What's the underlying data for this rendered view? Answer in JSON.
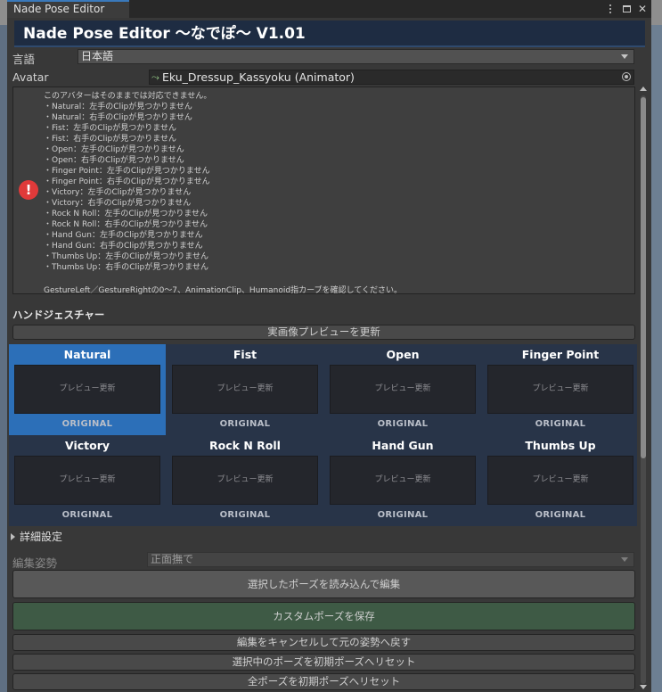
{
  "window": {
    "tab_title": "Nade Pose Editor",
    "header_title": "Nade Pose Editor 〜なでぽ〜 V1.01"
  },
  "language": {
    "label": "言語",
    "value": "日本語"
  },
  "avatar": {
    "label": "Avatar",
    "value": "Eku_Dressup_Kassyoku (Animator)"
  },
  "warning": {
    "intro": "このアバターはそのままでは対応できません。",
    "lines": [
      "・Natural：左手のClipが見つかりません",
      "・Natural：右手のClipが見つかりません",
      "・Fist：左手のClipが見つかりません",
      "・Fist：右手のClipが見つかりません",
      "・Open：左手のClipが見つかりません",
      "・Open：右手のClipが見つかりません",
      "・Finger Point：左手のClipが見つかりません",
      "・Finger Point：右手のClipが見つかりません",
      "・Victory：左手のClipが見つかりません",
      "・Victory：右手のClipが見つかりません",
      "・Rock N Roll：左手のClipが見つかりません",
      "・Rock N Roll：右手のClipが見つかりません",
      "・Hand Gun：左手のClipが見つかりません",
      "・Hand Gun：右手のClipが見つかりません",
      "・Thumbs Up：左手のClipが見つかりません",
      "・Thumbs Up：右手のClipが見つかりません"
    ],
    "footer": "GestureLeft／GestureRightの0〜7、AnimationClip、Humanoid指カーブを確認してください。"
  },
  "gestures": {
    "section_title": "ハンドジェスチャー",
    "refresh_button": "実画像プレビューを更新",
    "items": [
      {
        "name": "Natural",
        "preview": "プレビュー更新",
        "tag": "ORIGINAL",
        "selected": true
      },
      {
        "name": "Fist",
        "preview": "プレビュー更新",
        "tag": "ORIGINAL",
        "selected": false
      },
      {
        "name": "Open",
        "preview": "プレビュー更新",
        "tag": "ORIGINAL",
        "selected": false
      },
      {
        "name": "Finger Point",
        "preview": "プレビュー更新",
        "tag": "ORIGINAL",
        "selected": false
      },
      {
        "name": "Victory",
        "preview": "プレビュー更新",
        "tag": "ORIGINAL",
        "selected": false
      },
      {
        "name": "Rock N Roll",
        "preview": "プレビュー更新",
        "tag": "ORIGINAL",
        "selected": false
      },
      {
        "name": "Hand Gun",
        "preview": "プレビュー更新",
        "tag": "ORIGINAL",
        "selected": false
      },
      {
        "name": "Thumbs Up",
        "preview": "プレビュー更新",
        "tag": "ORIGINAL",
        "selected": false
      }
    ]
  },
  "details": {
    "foldout_label": "詳細設定"
  },
  "edit": {
    "pose_label": "編集姿勢",
    "pose_value": "正面撫で",
    "load_button": "選択したポーズを読み込んで編集",
    "save_button": "カスタムポーズを保存",
    "cancel_button": "編集をキャンセルして元の姿勢へ戻す",
    "reset_selected_button": "選択中のポーズを初期ポーズへリセット",
    "reset_all_button": "全ポーズを初期ポーズへリセット"
  },
  "colors": {
    "selected_cell": "#2c6fb8",
    "grid_background": "#283448",
    "header_background": "#1e2c42",
    "error_icon": "#e03a3a",
    "save_button": "#3e5a45"
  }
}
